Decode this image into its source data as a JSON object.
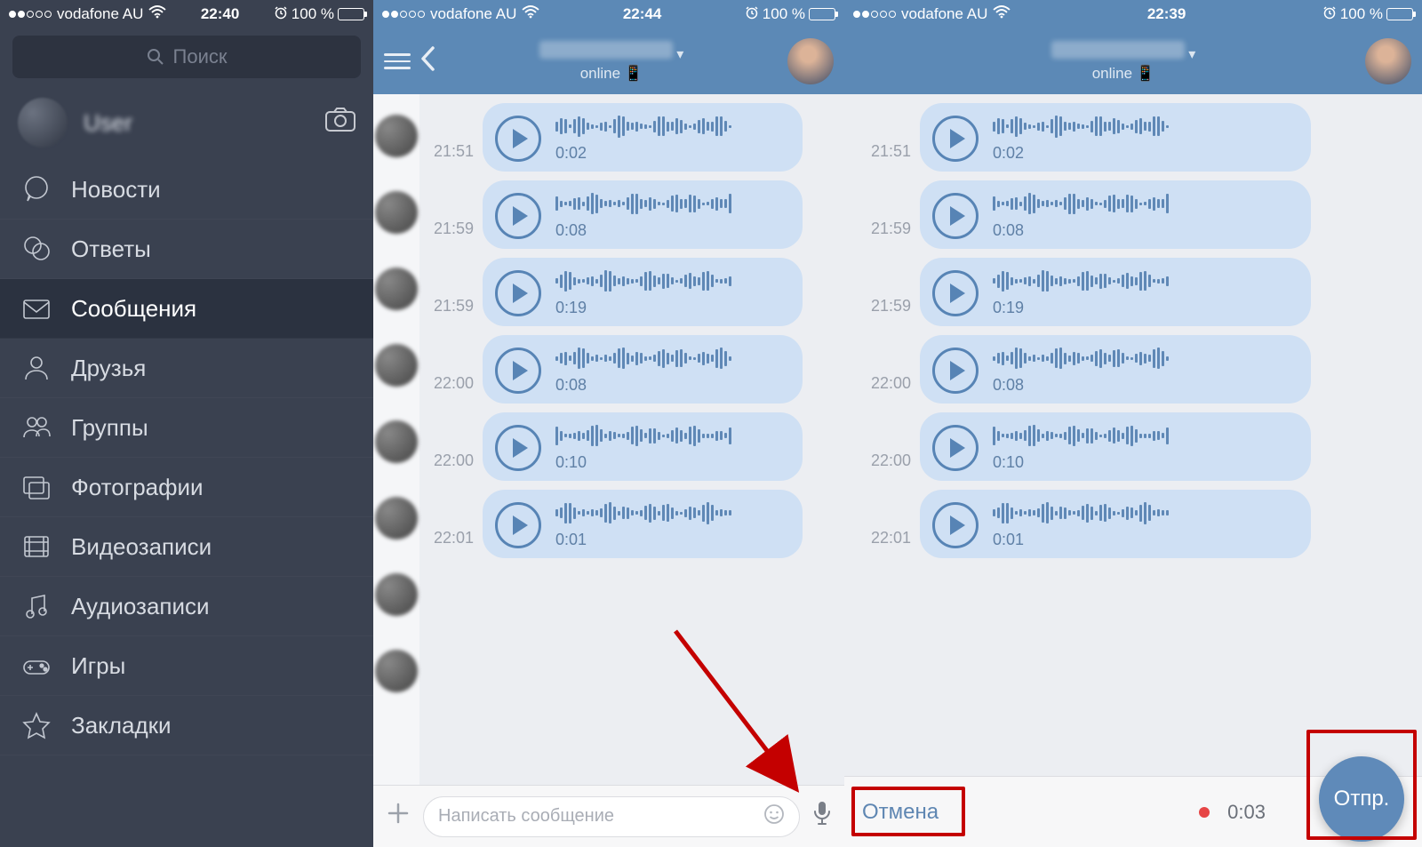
{
  "status": {
    "carrier": "vodafone AU",
    "t1": "22:40",
    "t2": "22:44",
    "t3": "22:39",
    "batt": "100 %"
  },
  "search": {
    "placeholder": "Поиск"
  },
  "profile": {
    "name": "User"
  },
  "menu": [
    {
      "label": "Новости",
      "icon": "bubble"
    },
    {
      "label": "Ответы",
      "icon": "bubbles"
    },
    {
      "label": "Сообщения",
      "icon": "envelope",
      "active": true
    },
    {
      "label": "Друзья",
      "icon": "person"
    },
    {
      "label": "Группы",
      "icon": "people"
    },
    {
      "label": "Фотографии",
      "icon": "photos"
    },
    {
      "label": "Видеозаписи",
      "icon": "film"
    },
    {
      "label": "Аудиозаписи",
      "icon": "music"
    },
    {
      "label": "Игры",
      "icon": "gamepad"
    },
    {
      "label": "Закладки",
      "icon": "star"
    }
  ],
  "chat": {
    "status": "online",
    "messages": [
      {
        "time": "21:51",
        "dur": "0:02"
      },
      {
        "time": "21:59",
        "dur": "0:08"
      },
      {
        "time": "21:59",
        "dur": "0:19"
      },
      {
        "time": "22:00",
        "dur": "0:08"
      },
      {
        "time": "22:00",
        "dur": "0:10"
      },
      {
        "time": "22:01",
        "dur": "0:01"
      }
    ],
    "composer": {
      "placeholder": "Написать сообщение"
    },
    "record": {
      "cancel": "Отмена",
      "time": "0:03",
      "send": "Отпр."
    }
  }
}
